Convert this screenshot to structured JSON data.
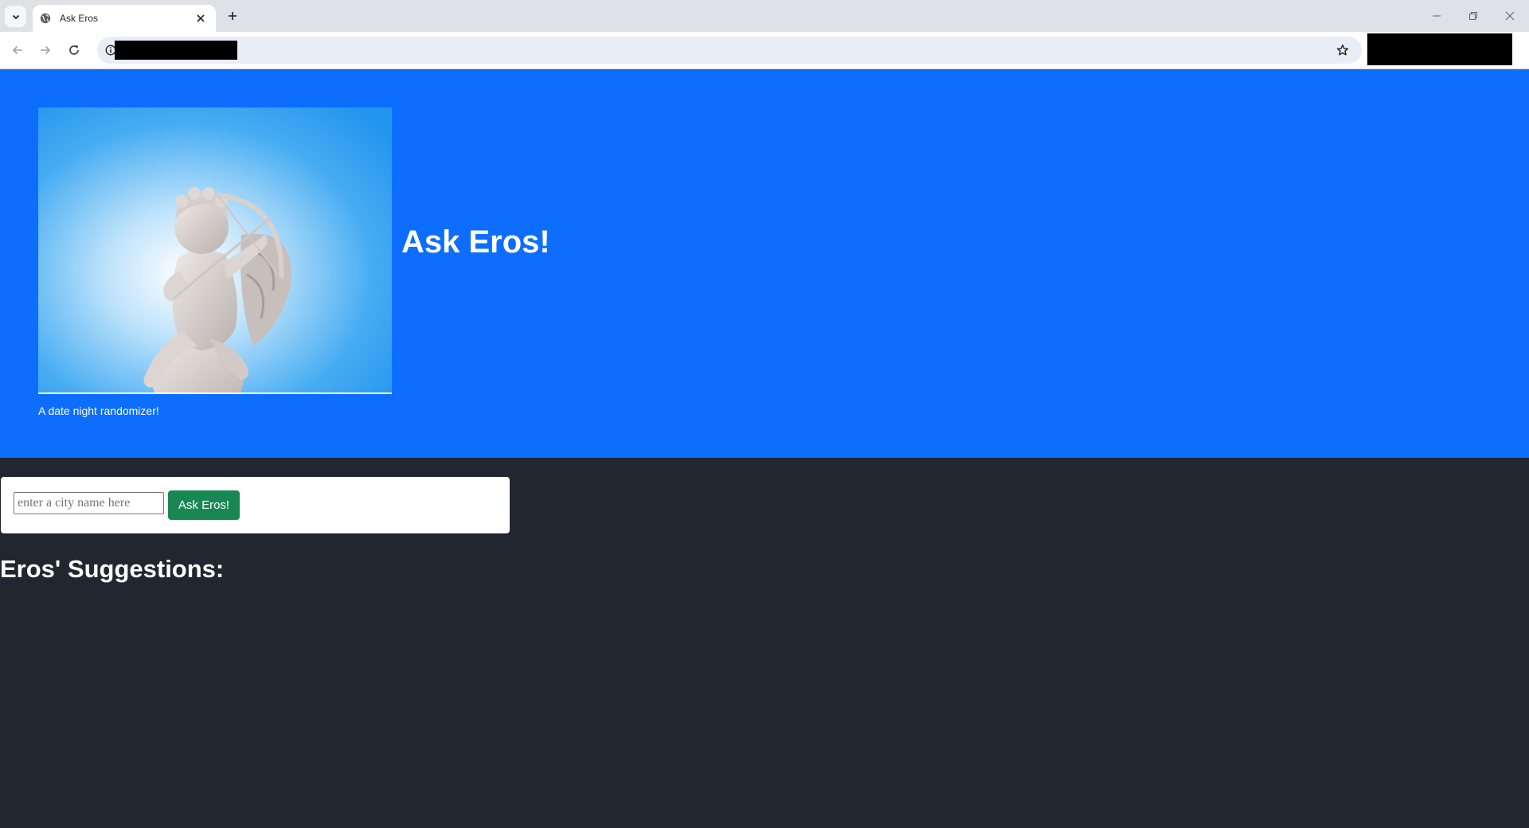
{
  "browser": {
    "tab_title": "Ask Eros",
    "icons": {
      "tab_search": "chevron-down-icon",
      "favicon": "globe-icon",
      "tab_close": "close-icon",
      "new_tab": "plus-icon",
      "back": "arrow-left-icon",
      "forward": "arrow-right-icon",
      "reload": "reload-icon",
      "site_info": "info-icon",
      "bookmark": "star-icon",
      "minimize": "minimize-icon",
      "restore": "restore-icon",
      "close_window": "close-icon"
    }
  },
  "hero": {
    "title": "Ask Eros!",
    "subtitle": "A date night randomizer!",
    "image_alt": "cupid statue"
  },
  "form": {
    "city_placeholder": "enter a city name here",
    "city_value": "",
    "submit_label": "Ask Eros!"
  },
  "suggestions": {
    "heading": "Eros' Suggestions:"
  },
  "colors": {
    "hero_bg": "#0d6efd",
    "page_bg": "#212730",
    "button_bg": "#198754"
  }
}
